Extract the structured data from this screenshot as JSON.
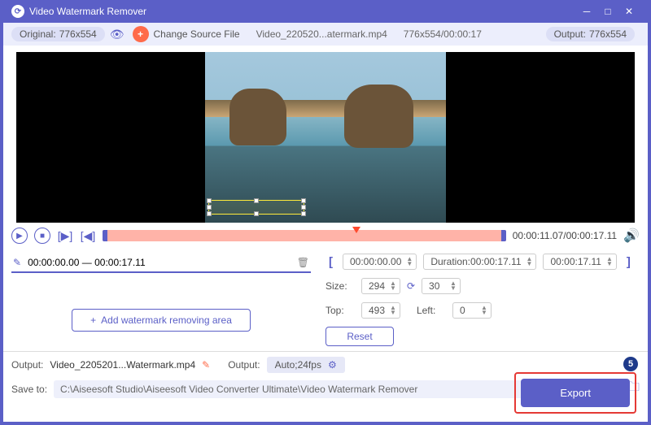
{
  "titlebar": {
    "title": "Video Watermark Remover"
  },
  "toolbar": {
    "original_label": "Original:",
    "original_dims": "776x554",
    "change_source": "Change Source File",
    "filename": "Video_220520...atermark.mp4",
    "file_meta": "776x554/00:00:17",
    "output_label": "Output:",
    "output_dims": "776x554"
  },
  "timeline": {
    "current": "00:00:11.07",
    "total": "00:00:17.11"
  },
  "segment": {
    "range": "00:00:00.00 — 00:00:17.11"
  },
  "add_area": "Add watermark removing area",
  "range": {
    "start": "00:00:00.00",
    "duration_label": "Duration:",
    "duration": "00:00:17.11",
    "end": "00:00:17.11"
  },
  "size": {
    "label": "Size:",
    "w": "294",
    "h": "30"
  },
  "pos": {
    "top_label": "Top:",
    "top": "493",
    "left_label": "Left:",
    "left": "0"
  },
  "reset": "Reset",
  "bottom": {
    "output_label": "Output:",
    "output_name": "Video_2205201...Watermark.mp4",
    "fmt_label": "Output:",
    "fmt_value": "Auto;24fps",
    "saveto_label": "Save to:",
    "path": "C:\\Aiseesoft Studio\\Aiseesoft Video Converter Ultimate\\Video Watermark Remover"
  },
  "export": "Export",
  "step": "5"
}
